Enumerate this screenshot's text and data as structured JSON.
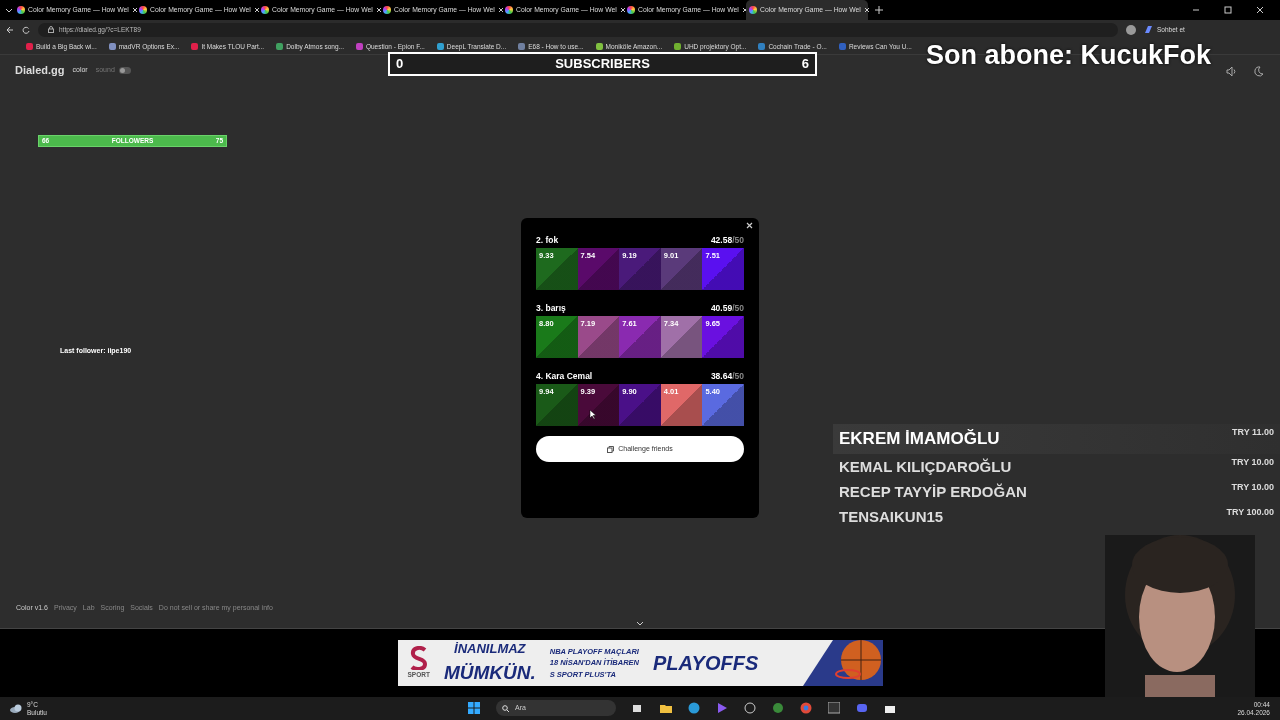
{
  "tabs": [
    {
      "title": "Color Memory Game — How Wel",
      "selected": false
    },
    {
      "title": "Color Memory Game — How Wel",
      "selected": false
    },
    {
      "title": "Color Memory Game — How Wel",
      "selected": false
    },
    {
      "title": "Color Memory Game — How Wel",
      "selected": false
    },
    {
      "title": "Color Memory Game — How Wel",
      "selected": false
    },
    {
      "title": "Color Memory Game — How Wel",
      "selected": false
    },
    {
      "title": "Color Memory Game — How Wel",
      "selected": true
    }
  ],
  "address": {
    "url": "https://dialed.gg/?c=LEKT89"
  },
  "copilot": {
    "label": "Sohbet et"
  },
  "bookmarks": [
    {
      "label": "Build a Big Back wi...",
      "color": "#e0204a"
    },
    {
      "label": "madVR Options Ex...",
      "color": "#8090c0"
    },
    {
      "label": "It Makes TLOU Part...",
      "color": "#e0204a"
    },
    {
      "label": "Dolby Atmos song...",
      "color": "#40a060"
    },
    {
      "label": "Question - Epion F...",
      "color": "#c040c0"
    },
    {
      "label": "DeepL Translate D...",
      "color": "#30a0d0"
    },
    {
      "label": "E68 - How to use...",
      "color": "#7080a0"
    },
    {
      "label": "Moniköle Amazon...",
      "color": "#80c040"
    },
    {
      "label": "UHD projektory Opt...",
      "color": "#70b030"
    },
    {
      "label": "Cochain Trade - O...",
      "color": "#3080c0"
    },
    {
      "label": "Reviews Can You U...",
      "color": "#3060c0"
    }
  ],
  "site": {
    "logo": "Dialed.gg",
    "nav": [
      {
        "label": "color",
        "selected": true
      },
      {
        "label": "sound",
        "selected": false
      }
    ],
    "sound_toggle": {
      "on": false
    }
  },
  "follower_goal": {
    "current": "66",
    "label": "FOLLOWERS",
    "target": "75"
  },
  "last_follower": "Last follower: iipe190",
  "subscriber_goal": {
    "current": "0",
    "label": "SUBSCRIBERS",
    "target": "6"
  },
  "last_subscriber": "Son abone: KucukFok",
  "leaderboard": [
    {
      "name": "2. fok",
      "score": "42.58",
      "max": "/50",
      "swatches": [
        {
          "value": "9.33",
          "color": "#1e6a1e"
        },
        {
          "value": "7.54",
          "color": "#5a0a6a"
        },
        {
          "value": "9.19",
          "color": "#4a1a7a"
        },
        {
          "value": "9.01",
          "color": "#5a3a7a"
        },
        {
          "value": "7.51",
          "color": "#5a10f0"
        }
      ]
    },
    {
      "name": "3. barış",
      "score": "40.59",
      "max": "/50",
      "swatches": [
        {
          "value": "8.80",
          "color": "#1a7a1a"
        },
        {
          "value": "7.19",
          "color": "#9a4a8a"
        },
        {
          "value": "7.61",
          "color": "#8a2ab0"
        },
        {
          "value": "7.34",
          "color": "#a070a8"
        },
        {
          "value": "9.65",
          "color": "#6a10e0"
        }
      ]
    },
    {
      "name": "4. Kara Cemal",
      "score": "38.64",
      "max": "/50",
      "swatches": [
        {
          "value": "9.94",
          "color": "#1a5a18"
        },
        {
          "value": "9.39",
          "color": "#4a0a3a"
        },
        {
          "value": "9.90",
          "color": "#4a1088"
        },
        {
          "value": "4.01",
          "color": "#e06868"
        },
        {
          "value": "5.40",
          "color": "#5a6ae0"
        }
      ]
    }
  ],
  "challenge_button": {
    "label": "Challenge friends"
  },
  "footer": [
    "Color v1.6",
    "Privacy",
    "Lab",
    "Scoring",
    "Socials",
    "Do not sell or share my personal info"
  ],
  "donations": [
    {
      "name": "EKREM İMAMOĞLU",
      "amount": "TRY 11.00",
      "selected": true
    },
    {
      "name": "KEMAL KILIÇDAROĞLU",
      "amount": "TRY 10.00",
      "selected": false
    },
    {
      "name": "RECEP TAYYİP ERDOĞAN",
      "amount": "TRY 10.00",
      "selected": false
    },
    {
      "name": "TENSAIKUN15",
      "amount": "TRY 100.00",
      "selected": false
    }
  ],
  "ad": {
    "brand": "SPORT",
    "slogan_1": "İNANILMAZ",
    "slogan_2": "MÜMKÜN.",
    "info_1": "NBA PLAYOFF MAÇLARI",
    "info_2": "18 NİSAN'DAN İTİBAREN",
    "info_3": "S SPORT PLUS'TA",
    "event": "PLAYOFFS"
  },
  "taskbar": {
    "temperature": "9°C",
    "weather": "Bulutlu",
    "search_placeholder": "Ara",
    "time": "00:44",
    "date": "26.04.2026"
  }
}
